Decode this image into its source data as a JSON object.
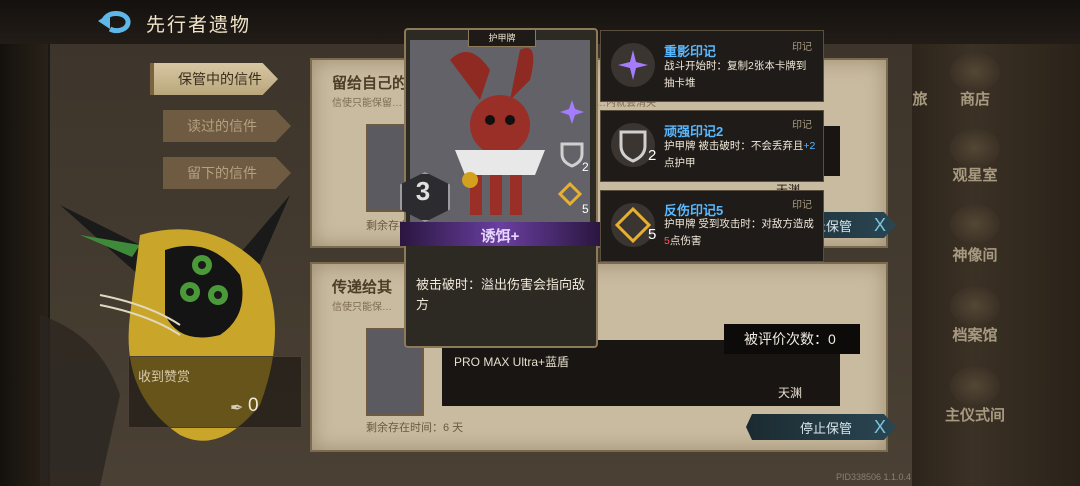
{
  "header": {
    "title": "先行者遗物"
  },
  "tabs": [
    {
      "label": "保管中的信件",
      "active": true
    },
    {
      "label": "读过的信件",
      "active": false
    },
    {
      "label": "留下的信件",
      "active": false
    }
  ],
  "praise": {
    "label": "收到赞赏",
    "count": "0"
  },
  "letters": [
    {
      "title": "留给自己的",
      "subtitle": "信使只能保留…",
      "sub_tail": "…内就会消失",
      "author": "天渊",
      "remaining": "剩余存在时…",
      "stop_label": "停止保管",
      "stop_x": "X"
    },
    {
      "title": "传递给其",
      "subtitle": "信使只能保…",
      "message": "PRO MAX Ultra+蓝盾",
      "author": "天渊",
      "remaining": "剩余存在时间：6 天",
      "stop_label": "停止保管",
      "stop_x": "X",
      "eval_label": "被评价次数：",
      "eval_count": "0"
    }
  ],
  "nav": [
    {
      "label": "旅",
      "icon": "scroll-icon"
    },
    {
      "label": "商店",
      "icon": "shop-icon"
    },
    {
      "label": "观星室",
      "icon": "star-icon"
    },
    {
      "label": "神像间",
      "icon": "statue-icon"
    },
    {
      "label": "档案馆",
      "icon": "archive-icon"
    },
    {
      "label": "主仪式间",
      "icon": "ritual-icon"
    }
  ],
  "card": {
    "type": "护甲牌",
    "cost": "3",
    "name": "诱饵+",
    "description": "被击破时：溢出伤害会指向敌方",
    "mark_counts": [
      "2",
      "5"
    ]
  },
  "marks": [
    {
      "title": "重影印记",
      "tag": "印记",
      "text": "战斗开始时：复制2张本卡牌到抽卡堆",
      "num": ""
    },
    {
      "title": "顽强印记2",
      "tag": "印记",
      "text_pre": "护甲牌 被击破时：不会丢弃且",
      "text_hl": "+2",
      "text_post": "点护甲",
      "num": "2"
    },
    {
      "title": "反伤印记5",
      "tag": "印记",
      "text_pre": "护甲牌 受到攻击时：对敌方造成",
      "text_hl": "5",
      "text_post": "点伤害",
      "num": "5"
    }
  ],
  "pid": "PID338506 1.1.0.4",
  "colors": {
    "accent_blue": "#5ab8ff",
    "highlight_red": "#ff5a5a",
    "card_purple": "#6a3fa0"
  }
}
